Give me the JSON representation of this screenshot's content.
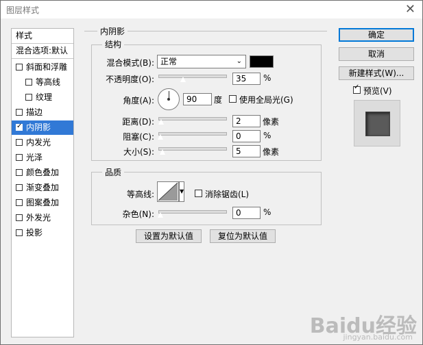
{
  "window": {
    "title": "图层样式",
    "close_icon": "close-icon"
  },
  "sidebar": {
    "header": "样式",
    "blend_options": "混合选项:默认",
    "items": [
      {
        "label": "斜面和浮雕",
        "checked": false
      },
      {
        "label": "等高线",
        "checked": false
      },
      {
        "label": "纹理",
        "checked": false
      },
      {
        "label": "描边",
        "checked": false
      },
      {
        "label": "内阴影",
        "checked": true,
        "selected": true
      },
      {
        "label": "内发光",
        "checked": false
      },
      {
        "label": "光泽",
        "checked": false
      },
      {
        "label": "颜色叠加",
        "checked": false
      },
      {
        "label": "渐变叠加",
        "checked": false
      },
      {
        "label": "图案叠加",
        "checked": false
      },
      {
        "label": "外发光",
        "checked": false
      },
      {
        "label": "投影",
        "checked": false
      }
    ]
  },
  "panel": {
    "title": "内阴影",
    "structure": {
      "title": "结构",
      "blend_mode_label": "混合模式(B):",
      "blend_mode_value": "正常",
      "color": "#000000",
      "opacity_label": "不透明度(O):",
      "opacity_value": "35",
      "percent": "%",
      "angle_label": "角度(A):",
      "angle_value": "90",
      "angle_unit": "度",
      "global_light_label": "使用全局光(G)",
      "distance_label": "距离(D):",
      "distance_value": "2",
      "pixel_unit": "像素",
      "choke_label": "阻塞(C):",
      "choke_value": "0",
      "size_label": "大小(S):",
      "size_value": "5"
    },
    "quality": {
      "title": "品质",
      "contour_label": "等高线:",
      "anti_alias_label": "消除锯齿(L)",
      "noise_label": "杂色(N):",
      "noise_value": "0",
      "percent": "%"
    },
    "set_default": "设置为默认值",
    "reset_default": "复位为默认值"
  },
  "right": {
    "ok": "确定",
    "cancel": "取消",
    "new_style": "新建样式(W)...",
    "preview_label": "预览(V)",
    "preview_checked": true
  },
  "watermark": {
    "main": "Baidu经验",
    "sub": "jingyan.baidu.com"
  }
}
